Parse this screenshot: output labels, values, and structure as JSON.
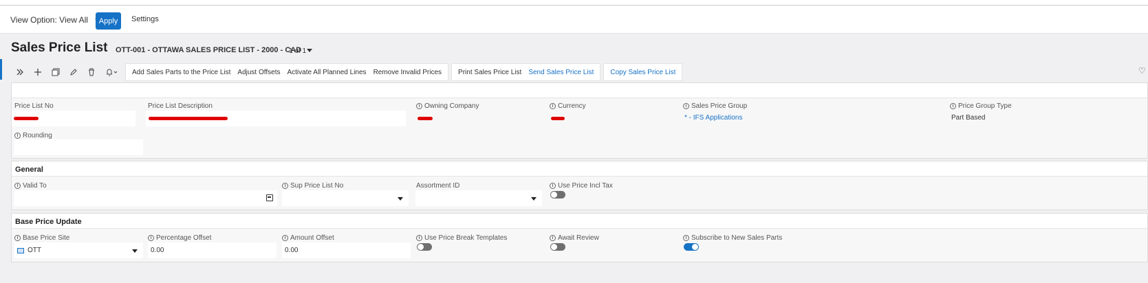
{
  "view_bar": {
    "view_option": "View Option: View All",
    "apply": "Apply",
    "settings": "Settings"
  },
  "header": {
    "title": "Sales Price List",
    "record": "OTT-001 - OTTAWA SALES PRICE LIST - 2000 - CAD",
    "count": "1 of 1"
  },
  "toolbar": {
    "icons": [
      "expand-icon",
      "add-icon",
      "duplicate-icon",
      "edit-icon",
      "delete-icon",
      "bell-icon"
    ],
    "group1": [
      "Add Sales Parts to the Price List",
      "Adjust Offsets",
      "Activate All Planned Lines",
      "Remove Invalid Prices"
    ],
    "print": "Print Sales Price List",
    "send": "Send Sales Price List",
    "copy": "Copy Sales Price List"
  },
  "main": {
    "price_list_no": {
      "label": "Price List No"
    },
    "description": {
      "label": "Price List Description"
    },
    "owning_company": {
      "label": "Owning Company"
    },
    "currency": {
      "label": "Currency"
    },
    "sales_price_group": {
      "label": "Sales Price Group",
      "value": "* - IFS Applications"
    },
    "price_group_type": {
      "label": "Price Group Type",
      "value": "Part Based"
    },
    "rounding": {
      "label": "Rounding"
    }
  },
  "general": {
    "title": "General",
    "valid_to": {
      "label": "Valid To"
    },
    "sup_price_list_no": {
      "label": "Sup Price List No"
    },
    "assortment_id": {
      "label": "Assortment ID"
    },
    "use_price_incl_tax": {
      "label": "Use Price Incl Tax",
      "checked": false
    }
  },
  "base_price_update": {
    "title": "Base Price Update",
    "base_price_site": {
      "label": "Base Price Site",
      "value": "OTT"
    },
    "percentage_offset": {
      "label": "Percentage Offset",
      "value": "0.00"
    },
    "amount_offset": {
      "label": "Amount Offset",
      "value": "0.00"
    },
    "use_price_break_templates": {
      "label": "Use Price Break Templates",
      "checked": false
    },
    "await_review": {
      "label": "Await Review",
      "checked": false
    },
    "subscribe_new_sales_parts": {
      "label": "Subscribe to New Sales Parts",
      "checked": true
    }
  },
  "colors": {
    "accent": "#1672c6",
    "redaction": "#e00000"
  }
}
